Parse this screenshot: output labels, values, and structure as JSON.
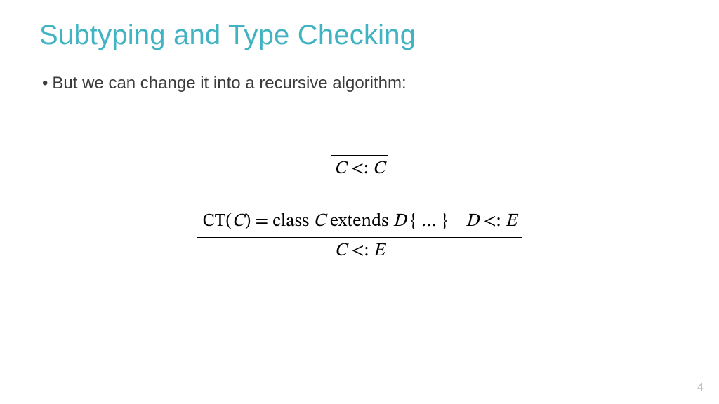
{
  "title": "Subtyping and Type Checking",
  "bullet": "But we can change it into a recursive algorithm:",
  "rule1": {
    "conclusion_C1": "C",
    "conclusion_rel": " <: ",
    "conclusion_C2": "C"
  },
  "rule2": {
    "premise1_CT": "CT",
    "premise1_lp": "(",
    "premise1_C": "C",
    "premise1_rp": ")",
    "premise1_eq": " = ",
    "premise1_class": "class ",
    "premise1_C2": "C",
    "premise1_extends": " extends ",
    "premise1_D": "D",
    "premise1_body": " { … }",
    "premise2_D": "D",
    "premise2_rel": " <: ",
    "premise2_E": "E",
    "conclusion_C": "C",
    "conclusion_rel": " <: ",
    "conclusion_E": "E"
  },
  "page_number": "4"
}
